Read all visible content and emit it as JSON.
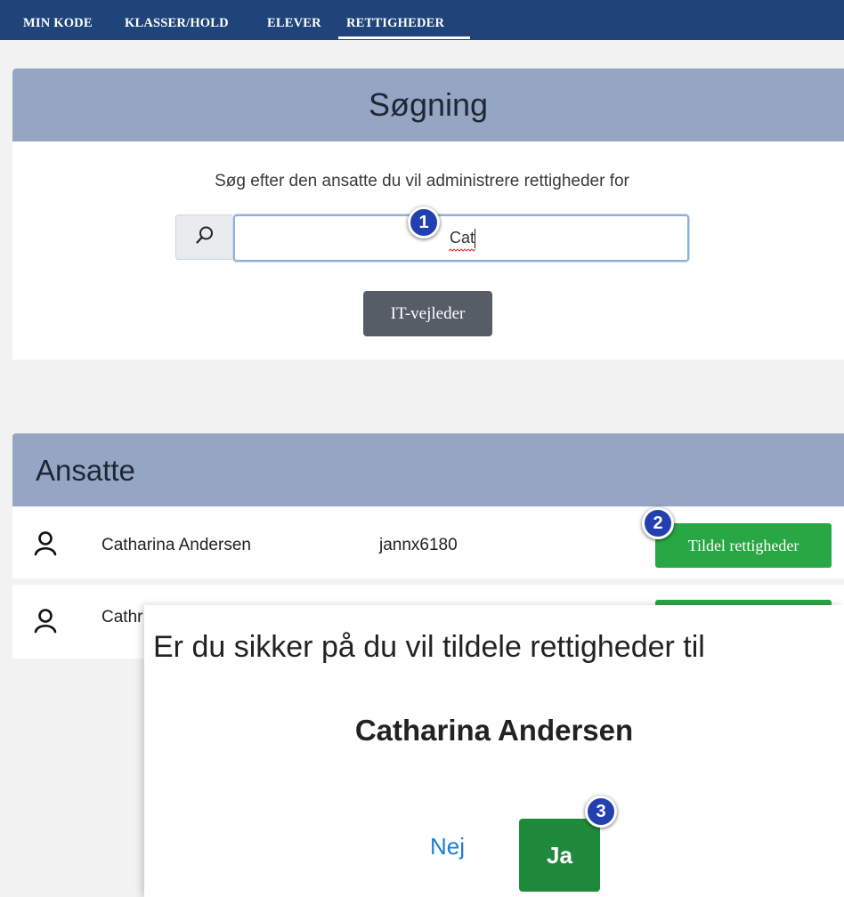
{
  "nav": {
    "items": [
      "MIN KODE",
      "KLASSER/HOLD",
      "ELEVER",
      "RETTIGHEDER"
    ],
    "active": "RETTIGHEDER"
  },
  "search": {
    "title": "Søgning",
    "description": "Søg efter den ansatte du vil administrere rettigheder for",
    "value": "Cat",
    "icon": "search-icon",
    "role_button": "IT-vejleder"
  },
  "employees": {
    "title": "Ansatte",
    "rows": [
      {
        "name": "Catharina Andersen",
        "username": "jannx6180",
        "button": "Tildel rettigheder"
      },
      {
        "name": "Cathr"
      }
    ]
  },
  "dialog": {
    "question": "Er du sikker på du vil tildele rettigheder til",
    "name": "Catharina Andersen",
    "no_label": "Nej",
    "yes_label": "Ja"
  },
  "badges": [
    "1",
    "2",
    "3"
  ],
  "colors": {
    "nav_bg": "#1e4479",
    "panel_header": "#94a6c4",
    "success": "#28a745",
    "confirm": "#1f8a3c",
    "badge": "#2340b0",
    "link": "#1a7ed6"
  }
}
